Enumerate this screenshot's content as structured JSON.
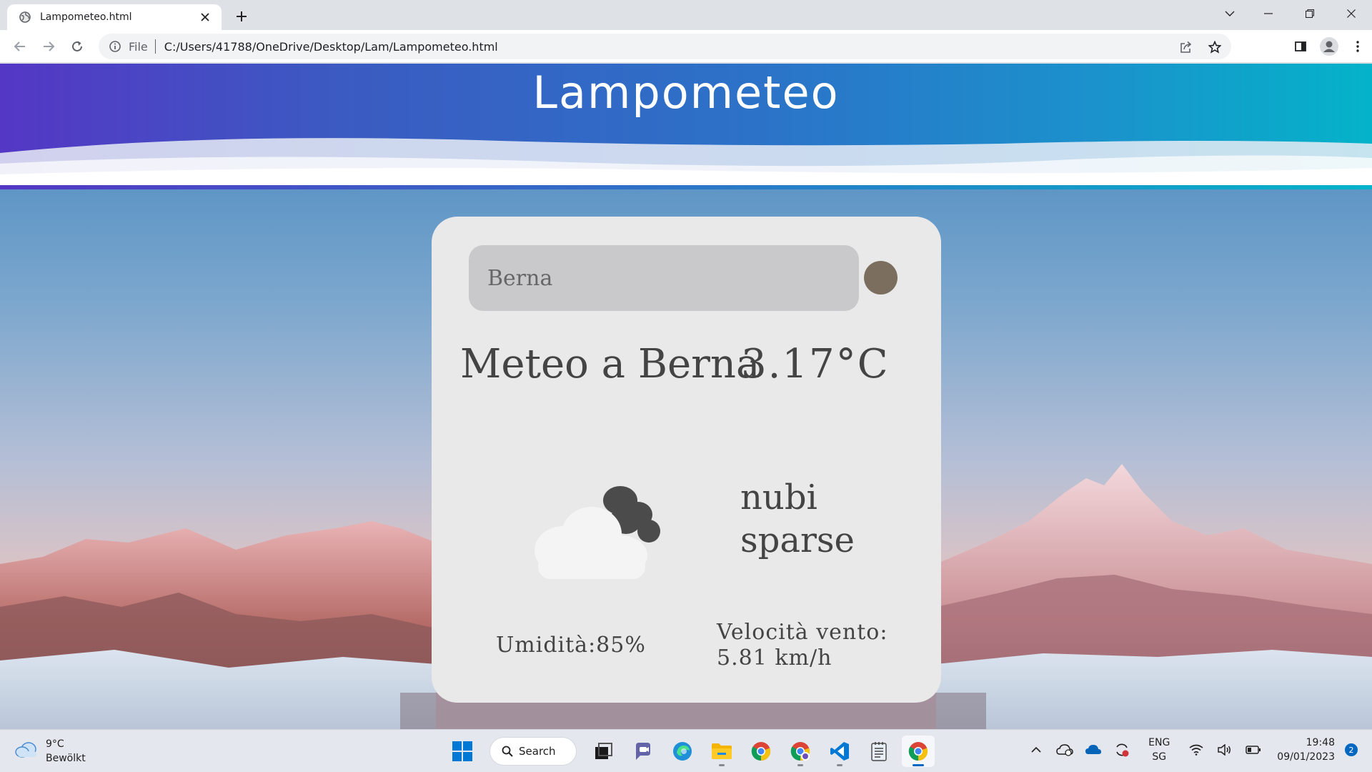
{
  "browser": {
    "tab_title": "Lampometeo.html",
    "scheme_label": "File",
    "url": "C:/Users/41788/OneDrive/Desktop/Lam/Lampometeo.html"
  },
  "page": {
    "site_title": "Lampometeo",
    "search": {
      "value": "Berna",
      "placeholder": "Berna"
    },
    "city_title": "Meteo a Berna",
    "temperature": "3.17°C",
    "description": "nubi sparse",
    "humidity": "Umidità:85%",
    "wind": "Velocità vento: 5.81 km/h",
    "weather_icon": "scattered-clouds-icon",
    "colors": {
      "header_start": "#5437c5",
      "header_end": "#04b3c9",
      "card_bg": "#e9e9ea",
      "search_button": "#7b6e5e"
    }
  },
  "taskbar": {
    "weather_temp": "9°C",
    "weather_desc": "Bewölkt",
    "search_label": "Search",
    "lang_top": "ENG",
    "lang_bottom": "SG",
    "time": "19:48",
    "date": "09/01/2023",
    "notification_count": "2"
  }
}
